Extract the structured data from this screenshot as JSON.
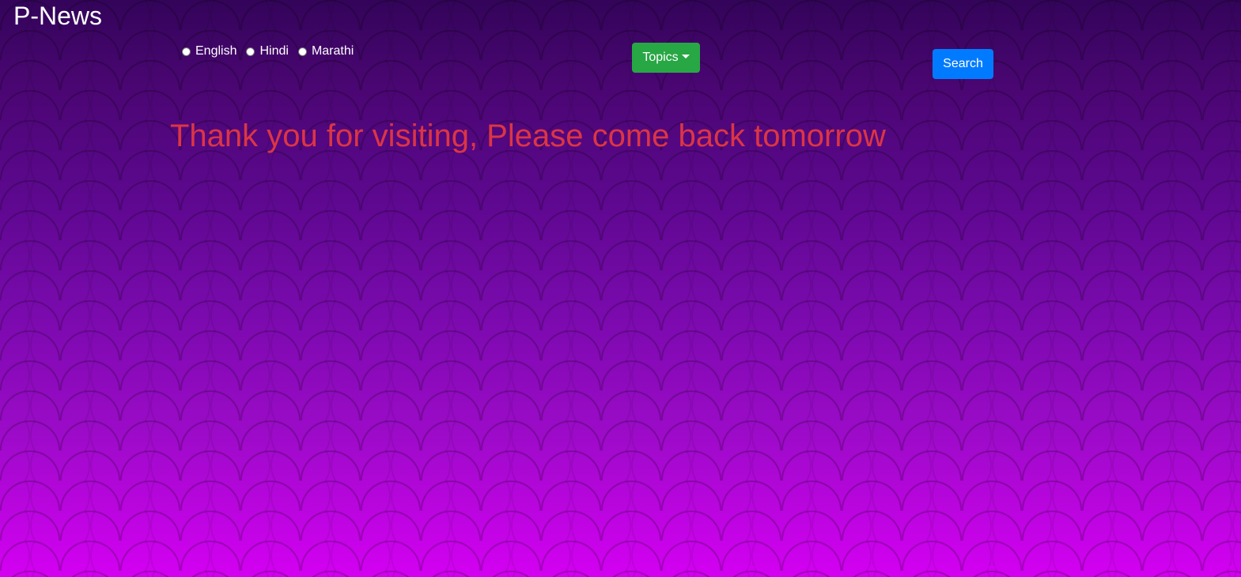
{
  "header": {
    "brand": "P-News"
  },
  "languages": [
    {
      "label": "English",
      "selected": false
    },
    {
      "label": "Hindi",
      "selected": false
    },
    {
      "label": "Marathi",
      "selected": false
    }
  ],
  "toolbar": {
    "topics_label": "Topics",
    "search_label": "Search"
  },
  "main": {
    "message": "Thank you for visiting, Please come back tomorrow"
  },
  "colors": {
    "topics_button": "#28a745",
    "search_button": "#007bff",
    "message_text": "#dc3545",
    "background_top": "#33045a",
    "background_bottom": "#d400f2"
  }
}
